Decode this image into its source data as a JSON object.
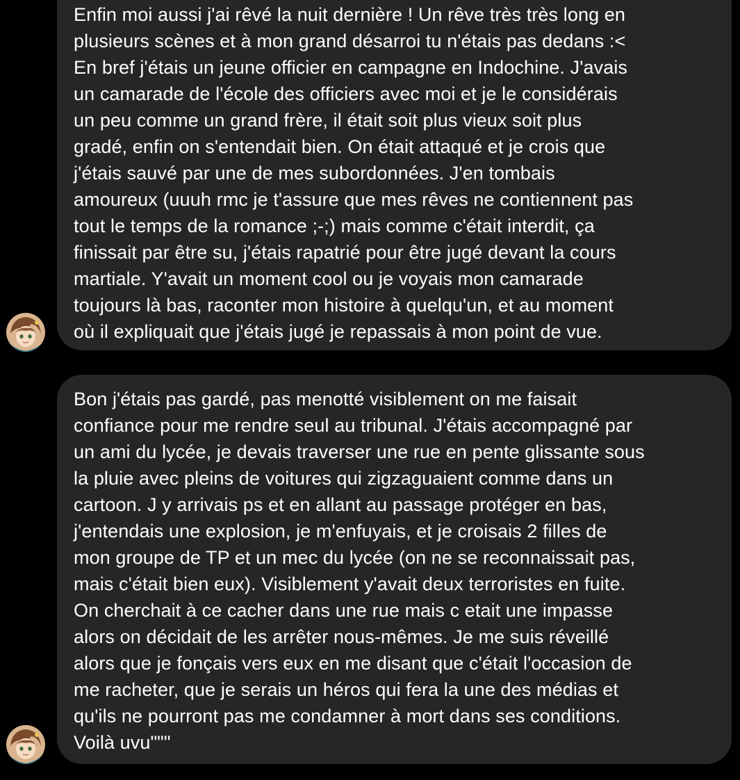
{
  "messages": [
    {
      "lines": [
        "Enfin moi aussi j'ai rêvé la nuit dernière ! Un rêve très très long en",
        "plusieurs scènes et à mon grand désarroi tu n'étais pas dedans :<",
        "En bref j'étais un jeune officier en campagne en Indochine. J'avais",
        "un camarade de l'école des officiers avec moi et je le considérais",
        "un peu comme un grand frère, il était soit plus vieux soit plus",
        "gradé, enfin on s'entendait bien. On était attaqué et je crois que",
        "j'étais sauvé par une de mes subordonnées. J'en tombais",
        "amoureux (uuuh rmc je t'assure que mes rêves ne contiennent pas",
        "tout le temps de la romance ;-;) mais comme c'était interdit, ça",
        "finissait par être su, j'étais rapatrié pour être jugé devant la cours",
        "martiale. Y'avait un moment cool ou je voyais mon camarade",
        "toujours là bas, raconter mon histoire à quelqu'un, et au moment",
        "où il expliquait que j'étais jugé je repassais à mon point de vue."
      ]
    },
    {
      "lines": [
        "Bon j'étais pas gardé, pas menotté visiblement on me faisait",
        "confiance pour me rendre seul au tribunal. J'étais accompagné par",
        "un ami du lycée, je devais traverser une rue en pente glissante sous",
        "la pluie avec pleins de voitures qui zigzaguaient comme dans un",
        "cartoon. J y arrivais ps et en allant au passage protéger en bas,",
        "j'entendais une explosion, je m'enfuyais, et je croisais 2 filles de",
        "mon groupe de TP et un mec du lycée (on ne se reconnaissait pas,",
        "mais c'était bien eux). Visiblement y'avait deux terroristes en fuite.",
        "On cherchait à ce cacher dans une rue mais c etait une impasse",
        "alors on décidait de les arrêter nous-mêmes. Je me suis réveillé",
        "alors que je fonçais vers eux en me disant que c'était l'occasion de",
        "me racheter, que je serais un héros qui fera la une des médias et",
        "qu'ils ne pourront pas me condamner à mort dans ses conditions.",
        "Voilà uvu\"\"\""
      ]
    }
  ],
  "colors": {
    "background": "#000000",
    "bubble": "#262626",
    "text": "#ffffff"
  },
  "icons": {
    "avatar": "sender-avatar"
  }
}
